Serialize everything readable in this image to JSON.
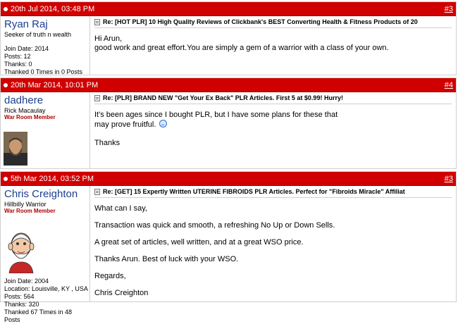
{
  "posts": [
    {
      "date": "20th Jul 2014, 03:48 PM",
      "number": "#3",
      "username": "Ryan Raj",
      "user_title": "Seeker of truth n wealth",
      "rank": "",
      "stats": [
        "Join Date: 2014",
        "Posts: 12",
        "Thanks: 0",
        "Thanked 0 Times in 0 Posts"
      ],
      "subject": "Re: [HOT PLR] 10 High Quality Reviews of Clickbank's BEST Converting Health & Fitness Products of 20",
      "message": [
        "Hi Arun,",
        "good work and great effort.You are simply a gem of a warrior with a class of your own."
      ]
    },
    {
      "date": "20th Mar 2014, 10:01 PM",
      "number": "#4",
      "username": "dadhere",
      "user_title": "Rick Macaulay",
      "rank": "War Room Member",
      "stats": [],
      "subject": "Re: [PLR] BRAND NEW \"Get Your Ex Back\" PLR Articles. First 5 at $0.99! Hurry!",
      "message": [
        "It's been ages since I bought PLR, but I have some plans for these that",
        "may prove fruitful.",
        "",
        "Thanks"
      ]
    },
    {
      "date": "5th Mar 2014, 03:52 PM",
      "number": "#3",
      "username": "Chris Creighton",
      "user_title": "Hillbilly Warrior",
      "rank": "War Room Member",
      "stats": [
        "Join Date: 2004",
        "Location: Louisville, KY , USA",
        "Posts: 564",
        "Thanks: 320",
        "Thanked 67 Times in 48 Posts"
      ],
      "subject": "Re: [GET] 15 Expertly Written UTERINE FIBROIDS PLR Articles. Perfect for \"Fibroids Miracle\" Affiliat",
      "message": [
        "What can I say,",
        "Transaction was quick and smooth, a refreshing No Up or Down Sells.",
        "A great set of articles, well written, and at a great WSO price.",
        "Thanks Arun. Best of luck with your WSO.",
        "Regards,",
        "Chris Creighton"
      ]
    }
  ],
  "colors": {
    "header": "#d00000",
    "username": "#1c3f8f",
    "rank": "#b00000"
  }
}
